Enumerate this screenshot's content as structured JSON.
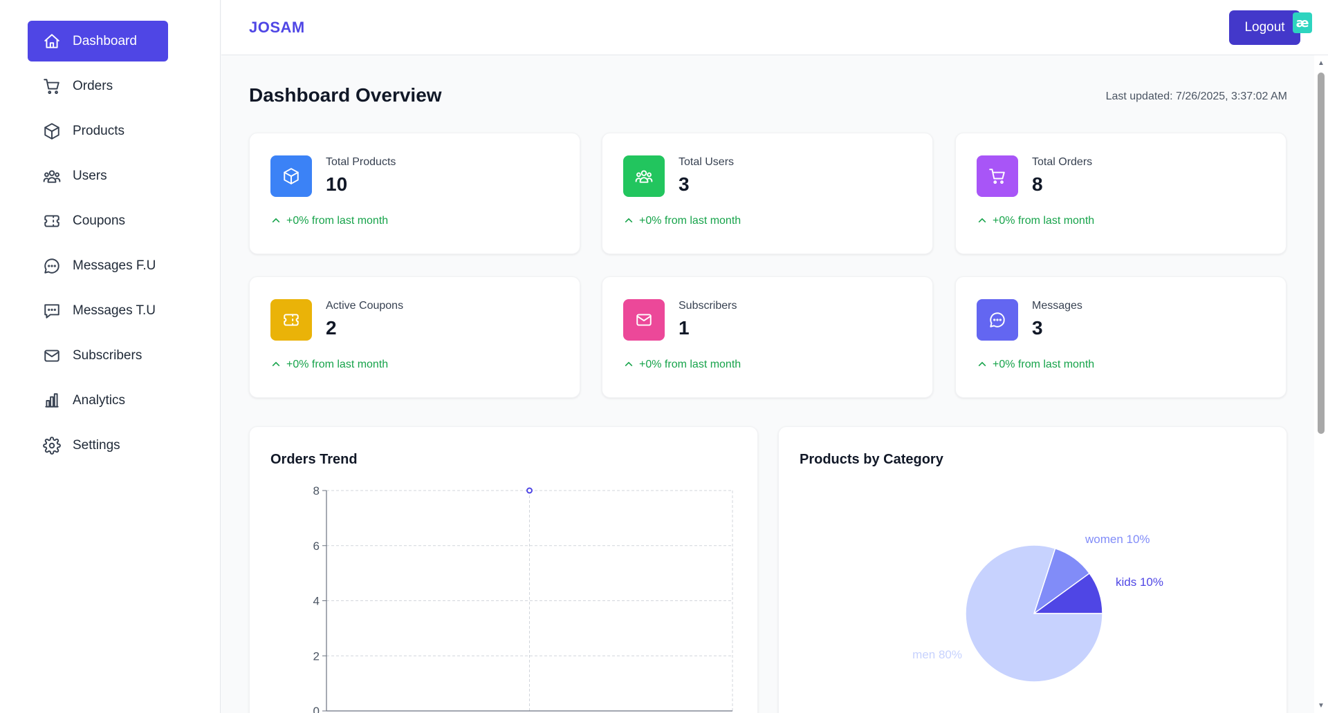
{
  "brand": "JOSAM",
  "logout_label": "Logout",
  "extension_badge": "æ",
  "sidebar": {
    "items": [
      {
        "label": "Dashboard",
        "icon": "home-icon",
        "active": true
      },
      {
        "label": "Orders",
        "icon": "cart-icon"
      },
      {
        "label": "Products",
        "icon": "box-icon"
      },
      {
        "label": "Users",
        "icon": "users-icon"
      },
      {
        "label": "Coupons",
        "icon": "ticket-icon"
      },
      {
        "label": "Messages F.U",
        "icon": "message-circle-icon"
      },
      {
        "label": "Messages T.U",
        "icon": "message-square-icon"
      },
      {
        "label": "Subscribers",
        "icon": "mail-icon"
      },
      {
        "label": "Analytics",
        "icon": "bar-chart-icon"
      },
      {
        "label": "Settings",
        "icon": "gear-icon"
      }
    ]
  },
  "main": {
    "title": "Dashboard Overview",
    "last_updated": "Last updated: 7/26/2025, 3:37:02 AM",
    "stats": [
      {
        "label": "Total Products",
        "value": "10",
        "trend": "+0% from last month",
        "icon": "box-icon",
        "color": "#3b82f6"
      },
      {
        "label": "Total Users",
        "value": "3",
        "trend": "+0% from last month",
        "icon": "users-icon",
        "color": "#22c55e"
      },
      {
        "label": "Total Orders",
        "value": "8",
        "trend": "+0% from last month",
        "icon": "cart-icon",
        "color": "#a855f7"
      },
      {
        "label": "Active Coupons",
        "value": "2",
        "trend": "+0% from last month",
        "icon": "ticket-icon",
        "color": "#eab308"
      },
      {
        "label": "Subscribers",
        "value": "1",
        "trend": "+0% from last month",
        "icon": "mail-icon",
        "color": "#ec4899"
      },
      {
        "label": "Messages",
        "value": "3",
        "trend": "+0% from last month",
        "icon": "message-circle-icon",
        "color": "#6366f1"
      }
    ]
  },
  "chart_data": [
    {
      "type": "line",
      "title": "Orders Trend",
      "ylim": [
        0,
        8
      ],
      "yticks": [
        "0",
        "2",
        "4",
        "6",
        "8"
      ],
      "points": [
        {
          "x": 1,
          "y": 8
        }
      ],
      "xlim": [
        0,
        2
      ],
      "grid": true,
      "color": "#4f46e5"
    },
    {
      "type": "pie",
      "title": "Products by Category",
      "slices": [
        {
          "label": "women 10%",
          "value": 10,
          "color": "#818cf8"
        },
        {
          "label": "kids 10%",
          "value": 10,
          "color": "#4f46e5"
        },
        {
          "label": "men 80%",
          "value": 80,
          "color": "#c7d2fe"
        }
      ]
    }
  ]
}
